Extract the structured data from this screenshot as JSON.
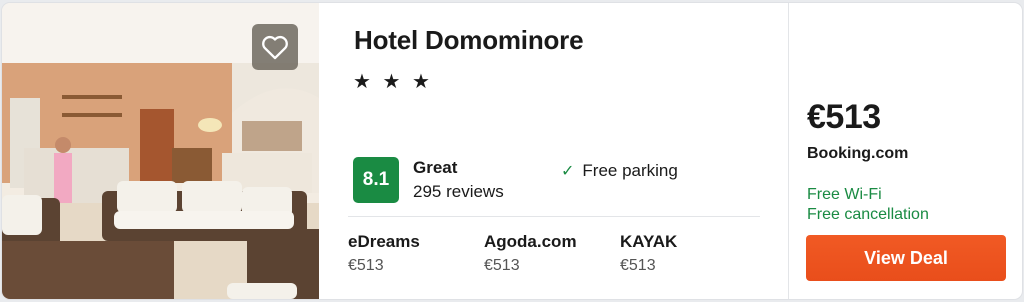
{
  "hotel": {
    "name": "Hotel Domominore",
    "stars": "★ ★ ★",
    "star_count": 3
  },
  "rating": {
    "score": "8.1",
    "label": "Great",
    "reviews": "295 reviews",
    "color": "#1a8b43"
  },
  "amenities": [
    {
      "label": "Free parking",
      "icon": "check-icon"
    }
  ],
  "providers": [
    {
      "name": "eDreams",
      "price": "€513"
    },
    {
      "name": "Agoda.com",
      "price": "€513"
    },
    {
      "name": "KAYAK",
      "price": "€513"
    }
  ],
  "deal": {
    "price": "€513",
    "site": "Booking.com",
    "perks": [
      "Free Wi-Fi",
      "Free cancellation"
    ],
    "perk_color": "#1a8b43",
    "button_label": "View Deal",
    "button_color": "#e94e1b"
  },
  "favorite": {
    "icon": "heart-icon"
  },
  "photo": {
    "subject": "hotel lobby photo"
  }
}
